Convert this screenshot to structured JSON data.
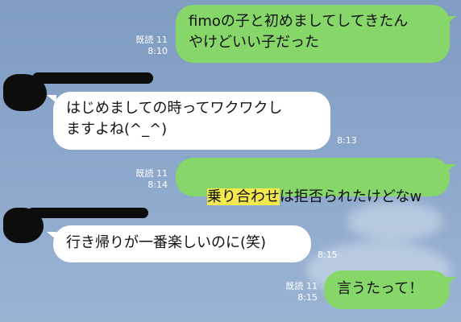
{
  "colors": {
    "background": "#8aa6ca",
    "outgoing_bubble": "#86d66a",
    "incoming_bubble": "#ffffff",
    "highlight": "#f3e94f"
  },
  "messages": [
    {
      "direction": "outgoing",
      "text": "fimoの子と初めましてしてきたん\nやけどいい子だった",
      "read": "既読 11",
      "time": "8:10"
    },
    {
      "direction": "incoming",
      "text": "はじめましての時ってワクワクし\nますよね(^_^)",
      "time": "8:13"
    },
    {
      "direction": "outgoing",
      "highlighted": "乗り合わせ",
      "text_rest": "は拒否られたけどなw",
      "read": "既読 11",
      "time": "8:14"
    },
    {
      "direction": "incoming",
      "text": "行き帰りが一番楽しいのに(笑)",
      "time": "8:15"
    },
    {
      "direction": "outgoing",
      "text": "言うたって！",
      "read": "既読 11",
      "time": "8:15"
    }
  ]
}
